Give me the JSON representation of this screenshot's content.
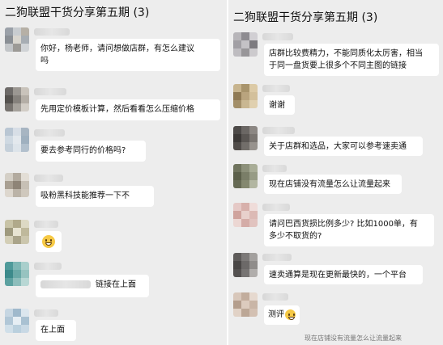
{
  "left": {
    "title": "二狗联盟干货分享第五期 (3)",
    "messages": [
      {
        "text": "你好，杨老师，请问想做店群，有怎么建议",
        "text2": "吗"
      },
      {
        "text": "先用定价模板计算，然后看看怎么压缩价格"
      },
      {
        "text": "要去参考同行的价格吗?"
      },
      {
        "text": "吸粉黑科技能推荐一下不"
      },
      {
        "text": "",
        "emoji": "grin-emoji"
      },
      {
        "text": "链接在上面"
      },
      {
        "text": "在上面"
      }
    ]
  },
  "right": {
    "title": "二狗联盟干货分享第五期 (3)",
    "messages": [
      {
        "text": "店群比较费精力，不能同质化太厉害，相当",
        "text2": "于同一盘货要上很多个不同主图的链接"
      },
      {
        "text": "谢谢"
      },
      {
        "text": "关于店群和选品，大家可以参考速卖通"
      },
      {
        "text": "现在店铺没有流量怎么让流量起来"
      },
      {
        "text": "请问巴西货损比例多少? 比如1000单，有",
        "text2": "多少不取货的?"
      },
      {
        "text": "速卖通算是现在更新最快的，一个平台"
      },
      {
        "text": "测评",
        "emoji": "grin-emoji"
      }
    ],
    "caption": "现在店铺没有流量怎么让流量起来"
  }
}
